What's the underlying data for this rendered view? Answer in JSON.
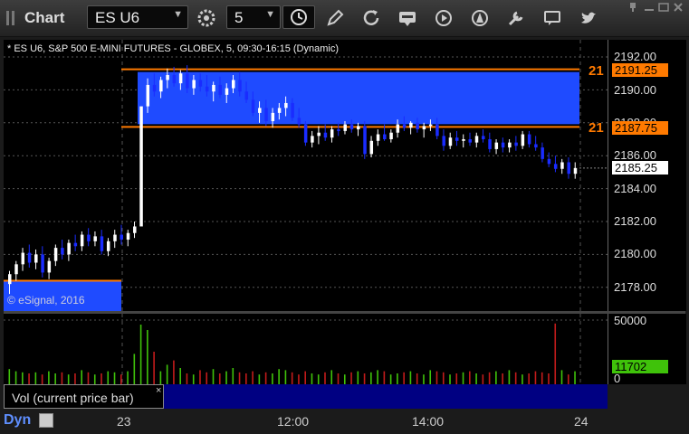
{
  "window": {
    "title": "Chart"
  },
  "toolbar": {
    "symbol": "ES U6",
    "interval": "5",
    "icons": [
      "settings-icon",
      "clock-icon",
      "pencil-icon",
      "refresh-icon",
      "get-icon",
      "play-icon",
      "compass-icon",
      "wrench-icon",
      "chat-icon",
      "twitter-icon"
    ]
  },
  "chart": {
    "header": "* ES U6, S&P 500 E-MINI FUTURES - GLOBEX, 5, 09:30-16:15 (Dynamic)",
    "watermark": "© eSignal, 2016",
    "y_labels": [
      "2192.00",
      "2190.00",
      "2188.00",
      "2186.00",
      "2184.00",
      "2182.00",
      "2180.00",
      "2178.00"
    ],
    "levels": [
      {
        "price_label": "2191.25",
        "edge_text": "21"
      },
      {
        "price_label": "2187.75",
        "edge_text": "21"
      }
    ],
    "last_price": "2185.25"
  },
  "volume": {
    "y_labels": [
      "50000",
      "0"
    ],
    "last_volume": "11702",
    "study_label": "Vol (current price bar)",
    "close_glyph": "×"
  },
  "xaxis": {
    "labels": [
      "23",
      "12:00",
      "14:00",
      "24"
    ]
  },
  "footer": {
    "mode": "Dyn"
  },
  "chart_data": {
    "type": "candlestick",
    "title": "* ES U6, S&P 500 E-MINI FUTURES - GLOBEX, 5, 09:30-16:15 (Dynamic)",
    "ylim": [
      2177,
      2193
    ],
    "levels": [
      2191.25,
      2187.75
    ],
    "last": 2185.25,
    "x_ticks": [
      "23",
      "12:00",
      "14:00",
      "24"
    ],
    "bars": [
      [
        2178.2,
        2179.0,
        2177.6,
        2178.8
      ],
      [
        2178.8,
        2179.6,
        2178.4,
        2179.4
      ],
      [
        2179.4,
        2180.4,
        2179.0,
        2180.1
      ],
      [
        2180.1,
        2180.6,
        2179.2,
        2179.5
      ],
      [
        2179.5,
        2180.3,
        2179.1,
        2180.0
      ],
      [
        2180.0,
        2180.5,
        2178.6,
        2178.9
      ],
      [
        2178.9,
        2179.8,
        2178.5,
        2179.6
      ],
      [
        2179.6,
        2180.6,
        2179.3,
        2180.4
      ],
      [
        2180.4,
        2180.9,
        2179.7,
        2180.0
      ],
      [
        2180.0,
        2180.9,
        2179.6,
        2180.7
      ],
      [
        2180.7,
        2181.2,
        2180.2,
        2180.5
      ],
      [
        2180.5,
        2181.4,
        2180.2,
        2181.2
      ],
      [
        2181.2,
        2181.6,
        2180.5,
        2180.8
      ],
      [
        2180.8,
        2181.4,
        2180.5,
        2181.1
      ],
      [
        2181.1,
        2181.5,
        2180.0,
        2180.2
      ],
      [
        2180.2,
        2181.0,
        2179.9,
        2180.8
      ],
      [
        2180.8,
        2181.5,
        2180.4,
        2181.2
      ],
      [
        2181.2,
        2181.8,
        2180.6,
        2180.9
      ],
      [
        2180.9,
        2181.5,
        2180.5,
        2181.3
      ],
      [
        2181.3,
        2182.0,
        2181.0,
        2181.7
      ],
      [
        2181.7,
        2188.4,
        2187.6,
        2189.0
      ],
      [
        2189.0,
        2190.7,
        2188.6,
        2190.3
      ],
      [
        2190.3,
        2191.0,
        2189.6,
        2189.9
      ],
      [
        2189.9,
        2190.8,
        2189.5,
        2190.6
      ],
      [
        2190.6,
        2191.3,
        2190.1,
        2190.9
      ],
      [
        2190.9,
        2191.4,
        2190.2,
        2190.4
      ],
      [
        2190.4,
        2191.2,
        2190.0,
        2191.0
      ],
      [
        2191.0,
        2191.5,
        2189.8,
        2190.1
      ],
      [
        2190.1,
        2190.9,
        2189.7,
        2190.6
      ],
      [
        2190.6,
        2191.0,
        2189.9,
        2190.2
      ],
      [
        2190.2,
        2190.9,
        2189.6,
        2189.9
      ],
      [
        2189.9,
        2190.5,
        2189.3,
        2190.3
      ],
      [
        2190.3,
        2190.8,
        2189.5,
        2189.7
      ],
      [
        2189.7,
        2190.4,
        2189.2,
        2190.1
      ],
      [
        2190.1,
        2190.9,
        2189.8,
        2190.6
      ],
      [
        2190.6,
        2191.1,
        2189.6,
        2189.9
      ],
      [
        2189.9,
        2190.5,
        2189.2,
        2189.4
      ],
      [
        2189.4,
        2189.9,
        2188.4,
        2188.6
      ],
      [
        2188.6,
        2189.3,
        2188.0,
        2188.9
      ],
      [
        2188.9,
        2189.4,
        2187.8,
        2188.1
      ],
      [
        2188.1,
        2188.9,
        2187.7,
        2188.6
      ],
      [
        2188.6,
        2189.2,
        2188.2,
        2188.9
      ],
      [
        2188.9,
        2189.6,
        2188.4,
        2189.2
      ],
      [
        2189.2,
        2189.5,
        2188.1,
        2188.3
      ],
      [
        2188.3,
        2188.9,
        2187.7,
        2187.9
      ],
      [
        2187.9,
        2188.1,
        2186.6,
        2186.8
      ],
      [
        2186.8,
        2187.5,
        2186.5,
        2187.2
      ],
      [
        2187.2,
        2187.8,
        2186.7,
        2187.4
      ],
      [
        2187.4,
        2187.9,
        2186.9,
        2187.1
      ],
      [
        2187.1,
        2187.8,
        2186.8,
        2187.6
      ],
      [
        2187.6,
        2188.0,
        2187.2,
        2187.5
      ],
      [
        2187.5,
        2188.1,
        2187.3,
        2187.9
      ],
      [
        2187.9,
        2188.2,
        2187.4,
        2187.6
      ],
      [
        2187.6,
        2188.0,
        2187.2,
        2187.8
      ],
      [
        2187.8,
        2188.1,
        2185.8,
        2186.1
      ],
      [
        2186.1,
        2187.2,
        2185.9,
        2186.9
      ],
      [
        2186.9,
        2187.6,
        2186.6,
        2187.3
      ],
      [
        2187.3,
        2187.9,
        2186.9,
        2187.0
      ],
      [
        2187.0,
        2187.6,
        2186.8,
        2187.4
      ],
      [
        2187.4,
        2188.2,
        2187.1,
        2187.9
      ],
      [
        2187.9,
        2188.4,
        2187.5,
        2187.7
      ],
      [
        2187.7,
        2188.1,
        2187.3,
        2188.0
      ],
      [
        2188.0,
        2188.3,
        2187.4,
        2187.6
      ],
      [
        2187.6,
        2188.0,
        2187.1,
        2187.8
      ],
      [
        2187.8,
        2188.2,
        2187.5,
        2187.9
      ],
      [
        2187.9,
        2188.3,
        2187.0,
        2187.2
      ],
      [
        2187.2,
        2187.6,
        2186.3,
        2186.6
      ],
      [
        2186.6,
        2187.4,
        2186.4,
        2187.1
      ],
      [
        2187.1,
        2187.5,
        2186.6,
        2186.9
      ],
      [
        2186.9,
        2187.3,
        2186.5,
        2187.0
      ],
      [
        2187.0,
        2187.4,
        2186.6,
        2186.8
      ],
      [
        2186.8,
        2187.4,
        2186.5,
        2187.2
      ],
      [
        2187.2,
        2187.6,
        2186.8,
        2187.0
      ],
      [
        2187.0,
        2187.4,
        2186.2,
        2186.4
      ],
      [
        2186.4,
        2187.0,
        2186.1,
        2186.8
      ],
      [
        2186.8,
        2187.1,
        2186.2,
        2186.5
      ],
      [
        2186.5,
        2187.0,
        2186.2,
        2186.8
      ],
      [
        2186.8,
        2187.2,
        2186.3,
        2186.6
      ],
      [
        2186.6,
        2187.5,
        2186.4,
        2187.3
      ],
      [
        2187.3,
        2187.5,
        2186.5,
        2186.7
      ],
      [
        2186.7,
        2187.2,
        2186.3,
        2186.5
      ],
      [
        2186.5,
        2186.8,
        2185.6,
        2185.8
      ],
      [
        2185.8,
        2186.2,
        2185.3,
        2185.5
      ],
      [
        2185.5,
        2186.0,
        2185.0,
        2185.2
      ],
      [
        2185.2,
        2185.8,
        2184.9,
        2185.6
      ],
      [
        2185.6,
        2185.9,
        2184.6,
        2184.9
      ],
      [
        2184.9,
        2185.6,
        2184.6,
        2185.25
      ]
    ],
    "volume": {
      "ylim": [
        0,
        60000
      ],
      "ticks": [
        0,
        50000
      ],
      "last": 11702
    }
  }
}
